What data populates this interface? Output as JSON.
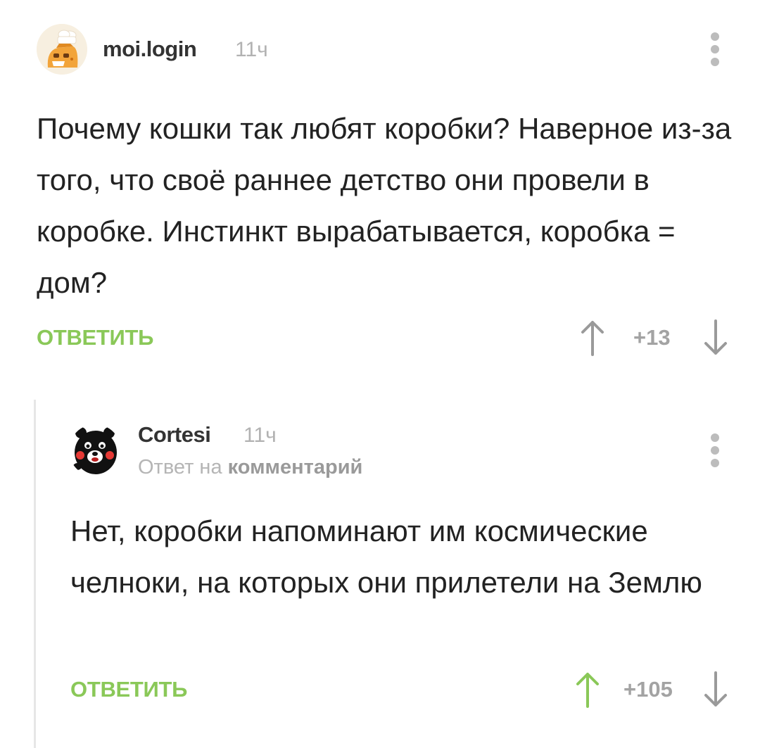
{
  "comments": [
    {
      "username": "moi.login",
      "time": "11ч",
      "text": "Почему кошки так любят коробки? Наверное из-за того, что своё раннее детство они провели в коробке. Инстинкт вырабатывается, коробка = дом?",
      "reply_label": "ОТВЕТИТЬ",
      "score": "+13",
      "upvote_active": false,
      "avatar_icon": "chef-cookie-avatar-icon"
    },
    {
      "username": "Cortesi",
      "time": "11ч",
      "reply_to_prefix": "Ответ на",
      "reply_to_link": "комментарий",
      "text": "Нет, коробки напоминают им космические челноки, на которых они прилетели на Землю",
      "reply_label": "ОТВЕТИТЬ",
      "score": "+105",
      "upvote_active": true,
      "avatar_icon": "kumamon-bear-avatar-icon"
    }
  ],
  "colors": {
    "accent_green": "#8ac858",
    "muted_gray": "#a3a3a3",
    "text": "#222222"
  }
}
